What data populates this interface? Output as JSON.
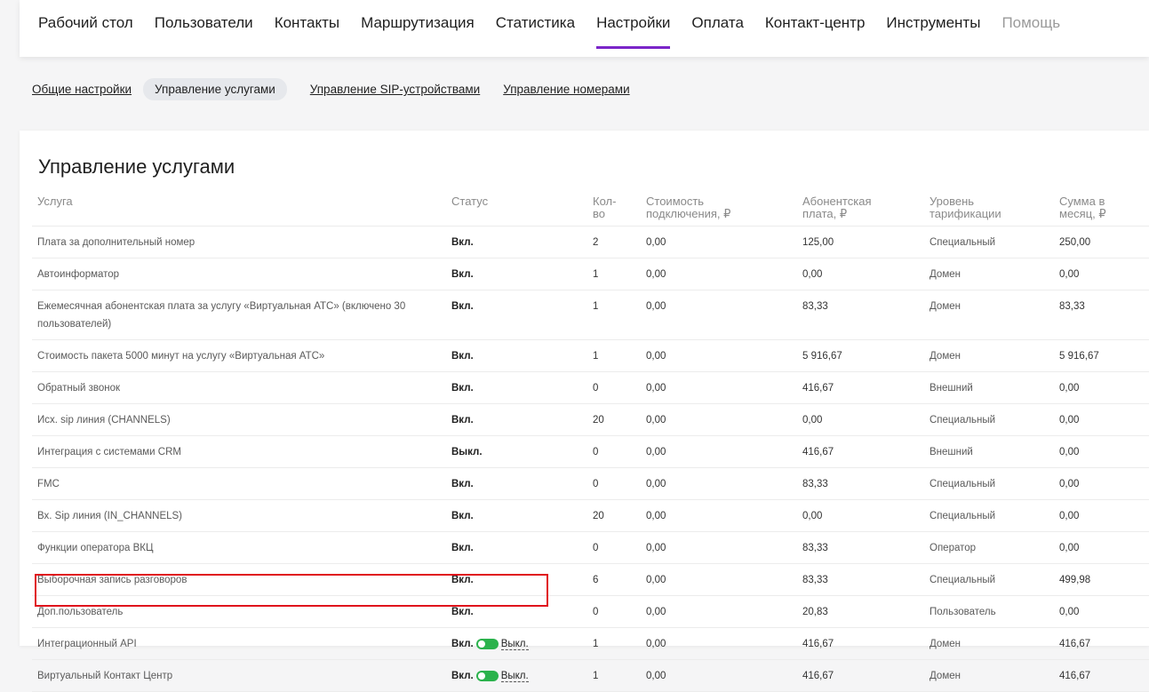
{
  "topnav": {
    "items": [
      "Рабочий стол",
      "Пользователи",
      "Контакты",
      "Маршрутизация",
      "Статистика",
      "Настройки",
      "Оплата",
      "Контакт-центр",
      "Инструменты",
      "Помощь"
    ],
    "active_index": 5,
    "muted_index": 9
  },
  "subnav": {
    "items": [
      "Общие настройки",
      "Управление услугами",
      "Управление SIP-устройствами",
      "Управление номерами"
    ],
    "active_index": 1
  },
  "page_title": "Управление услугами",
  "table": {
    "headers": [
      "Услуга",
      "Статус",
      "Кол-\nво",
      "Стоимость\nподключения, ₽",
      "Абонентская\nплата, ₽",
      "Уровень\nтарификации",
      "Сумма в\nмесяц, ₽"
    ],
    "rows": [
      {
        "service": "Плата за дополнительный номер",
        "status": "Вкл.",
        "toggle": false,
        "toggle_label": "",
        "qty": "2",
        "connect": "0,00",
        "fee": "125,00",
        "level": "Специальный",
        "sum": "250,00"
      },
      {
        "service": "Автоинформатор",
        "status": "Вкл.",
        "toggle": false,
        "toggle_label": "",
        "qty": "1",
        "connect": "0,00",
        "fee": "0,00",
        "level": "Домен",
        "sum": "0,00"
      },
      {
        "service": "Ежемесячная абонентская плата за услугу «Виртуальная АТС» (включено 30 пользователей)",
        "status": "Вкл.",
        "toggle": false,
        "toggle_label": "",
        "qty": "1",
        "connect": "0,00",
        "fee": "83,33",
        "level": "Домен",
        "sum": "83,33"
      },
      {
        "service": "Стоимость пакета 5000 минут на услугу «Виртуальная АТС»",
        "status": "Вкл.",
        "toggle": false,
        "toggle_label": "",
        "qty": "1",
        "connect": "0,00",
        "fee": "5 916,67",
        "level": "Домен",
        "sum": "5 916,67"
      },
      {
        "service": "Обратный звонок",
        "status": "Вкл.",
        "toggle": false,
        "toggle_label": "",
        "qty": "0",
        "connect": "0,00",
        "fee": "416,67",
        "level": "Внешний",
        "sum": "0,00"
      },
      {
        "service": "Исх. sip линия (CHANNELS)",
        "status": "Вкл.",
        "toggle": false,
        "toggle_label": "",
        "qty": "20",
        "connect": "0,00",
        "fee": "0,00",
        "level": "Специальный",
        "sum": "0,00"
      },
      {
        "service": "Интеграция с системами CRM",
        "status": "Выкл.",
        "toggle": false,
        "toggle_label": "",
        "qty": "0",
        "connect": "0,00",
        "fee": "416,67",
        "level": "Внешний",
        "sum": "0,00"
      },
      {
        "service": "FMC",
        "status": "Вкл.",
        "toggle": false,
        "toggle_label": "",
        "qty": "0",
        "connect": "0,00",
        "fee": "83,33",
        "level": "Специальный",
        "sum": "0,00"
      },
      {
        "service": "Вх. Sip линия (IN_CHANNELS)",
        "status": "Вкл.",
        "toggle": false,
        "toggle_label": "",
        "qty": "20",
        "connect": "0,00",
        "fee": "0,00",
        "level": "Специальный",
        "sum": "0,00"
      },
      {
        "service": "Функции оператора ВКЦ",
        "status": "Вкл.",
        "toggle": false,
        "toggle_label": "",
        "qty": "0",
        "connect": "0,00",
        "fee": "83,33",
        "level": "Оператор",
        "sum": "0,00"
      },
      {
        "service": "Выборочная запись разговоров",
        "status": "Вкл.",
        "toggle": false,
        "toggle_label": "",
        "qty": "6",
        "connect": "0,00",
        "fee": "83,33",
        "level": "Специальный",
        "sum": "499,98"
      },
      {
        "service": "Доп.пользователь",
        "status": "Вкл.",
        "toggle": false,
        "toggle_label": "",
        "qty": "0",
        "connect": "0,00",
        "fee": "20,83",
        "level": "Пользователь",
        "sum": "0,00"
      },
      {
        "service": "Интеграционный API",
        "status": "Вкл.",
        "toggle": true,
        "toggle_label": "Выкл.",
        "qty": "1",
        "connect": "0,00",
        "fee": "416,67",
        "level": "Домен",
        "sum": "416,67"
      },
      {
        "service": "Виртуальный Контакт Центр",
        "status": "Вкл.",
        "toggle": true,
        "toggle_label": "Выкл.",
        "qty": "1",
        "connect": "0,00",
        "fee": "416,67",
        "level": "Домен",
        "sum": "416,67"
      }
    ]
  },
  "colors": {
    "accent": "#7b25c9",
    "toggle_on": "#2bb24c",
    "highlight": "#e0131c"
  }
}
